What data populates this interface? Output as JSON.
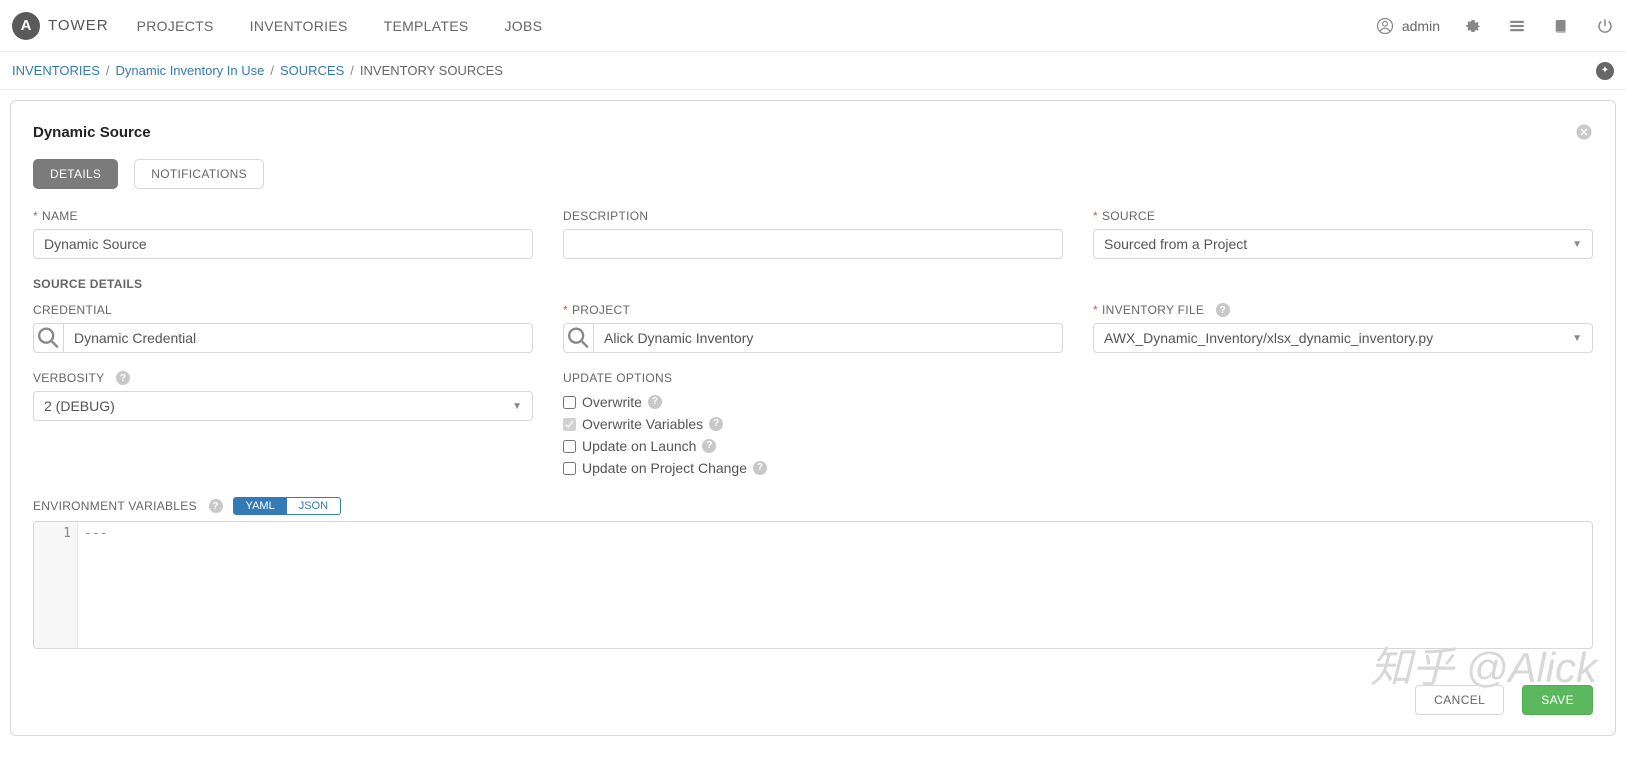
{
  "app": {
    "logo_letter": "A",
    "logo_text": "TOWER"
  },
  "nav": {
    "projects": "PROJECTS",
    "inventories": "INVENTORIES",
    "templates": "TEMPLATES",
    "jobs": "JOBS"
  },
  "user": {
    "name": "admin"
  },
  "breadcrumbs": {
    "inventories": "INVENTORIES",
    "inventory_name": "Dynamic Inventory In Use",
    "sources": "SOURCES",
    "current": "INVENTORY SOURCES"
  },
  "panel": {
    "title": "Dynamic Source"
  },
  "tabs": {
    "details": "DETAILS",
    "notifications": "NOTIFICATIONS"
  },
  "labels": {
    "name": "NAME",
    "description": "DESCRIPTION",
    "source": "SOURCE",
    "source_details": "SOURCE DETAILS",
    "credential": "CREDENTIAL",
    "project": "PROJECT",
    "inventory_file": "INVENTORY FILE",
    "verbosity": "VERBOSITY",
    "update_options": "UPDATE OPTIONS",
    "env_vars": "ENVIRONMENT VARIABLES"
  },
  "values": {
    "name": "Dynamic Source",
    "description": "",
    "source": "Sourced from a Project",
    "credential": "Dynamic Credential",
    "project": "Alick Dynamic Inventory",
    "inventory_file": "AWX_Dynamic_Inventory/xlsx_dynamic_inventory.py",
    "verbosity": "2 (DEBUG)"
  },
  "update_options": {
    "overwrite": "Overwrite",
    "overwrite_vars": "Overwrite Variables",
    "update_on_launch": "Update on Launch",
    "update_on_project_change": "Update on Project Change"
  },
  "format": {
    "yaml": "YAML",
    "json": "JSON"
  },
  "code": {
    "line1_number": "1",
    "line1_content": "---"
  },
  "buttons": {
    "cancel": "CANCEL",
    "save": "SAVE"
  },
  "watermark": "知乎  @Alick"
}
